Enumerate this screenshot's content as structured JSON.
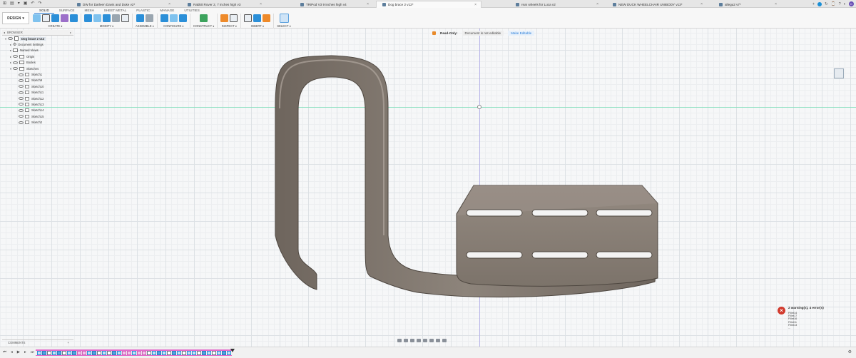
{
  "app_bar": {
    "icons": [
      "grid-icon",
      "file-icon",
      "save-icon",
      "undo-icon",
      "redo-icon"
    ],
    "glyphs": [
      "⊞",
      "▤",
      "▾",
      "▣",
      "↶",
      "↷"
    ],
    "right_glyphs": [
      "+",
      "↻",
      "⌚",
      "?",
      "◐"
    ],
    "avatar": "C"
  },
  "tabs": [
    {
      "label": "DW for Darleen Davis and Duke v2*"
    },
    {
      "label": "Rabbit Rover 2, 7 inches high v3"
    },
    {
      "label": "TRiPod V3 9 inches high v4"
    },
    {
      "label": "Dog brace 2 v12*",
      "active": true
    },
    {
      "label": "rear wheels for Luca v2"
    },
    {
      "label": "NEW DUCK WHEELCHAIR UNIBODY v13*"
    },
    {
      "label": "allegu2 v7*"
    }
  ],
  "toolbar": {
    "workspace": "DESIGN",
    "workspace_tabs": [
      "SOLID",
      "SURFACE",
      "MESH",
      "SHEET METAL",
      "PLASTIC",
      "MANAGE",
      "UTILITIES"
    ],
    "active_workspace_tab": "SOLID",
    "groups": [
      {
        "label": "CREATE ▾"
      },
      {
        "label": "MODIFY ▾"
      },
      {
        "label": "ASSEMBLE ▾"
      },
      {
        "label": "CONFIGURE ▾"
      },
      {
        "label": "CONSTRUCT ▾"
      },
      {
        "label": "INSPECT ▾"
      },
      {
        "label": "INSERT ▾"
      },
      {
        "label": "SELECT ▾"
      }
    ]
  },
  "readonly_banner": {
    "title": "Read-Only:",
    "message": "Document is not editable",
    "action": "Make Editable"
  },
  "browser": {
    "title": "BROWSER",
    "root": "Dog brace 2 v12",
    "items": [
      {
        "label": "Document Settings"
      },
      {
        "label": "Named Views"
      },
      {
        "label": "Origin"
      },
      {
        "label": "Bodies"
      },
      {
        "label": "Sketches"
      }
    ],
    "sketches": [
      "Sketch1",
      "Sketch9",
      "Sketch10",
      "Sketch11",
      "Sketch12",
      "Sketch13",
      "Sketch14",
      "Sketch15",
      "Sketch2"
    ]
  },
  "warnings": {
    "title": "2 warning(s), 4 error(s)",
    "items": [
      "Fillet14",
      "Fillet17",
      "Fillet16",
      "Fillet11",
      "Fillet13",
      "..."
    ]
  },
  "comments": {
    "label": "COMMENTS",
    "add": "+"
  },
  "colors": {
    "accent": "#2a7ed8",
    "body_fill": "#857b72",
    "timeline_pink": "#e36bcb",
    "error_red": "#d23a2d"
  }
}
